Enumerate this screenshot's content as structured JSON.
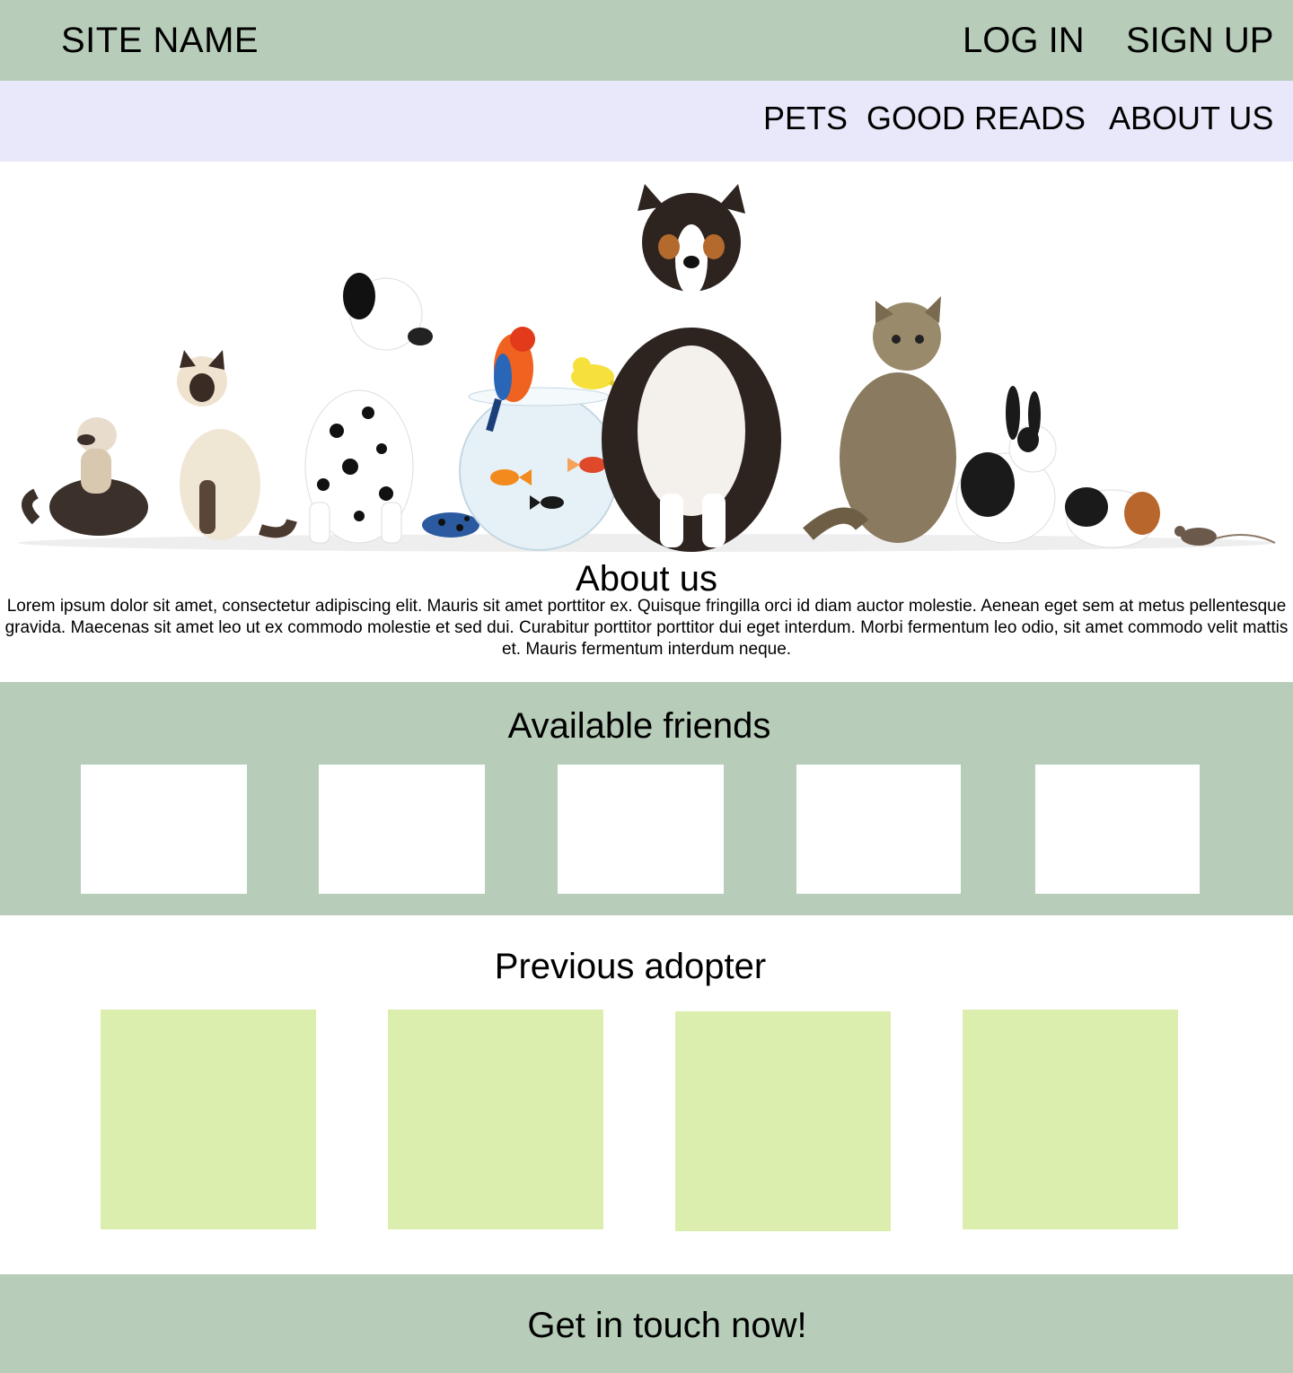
{
  "header": {
    "site_name": "SITE NAME",
    "login_label": "LOG IN",
    "signup_label": "SIGN UP"
  },
  "nav": {
    "items": [
      {
        "label": "PETS"
      },
      {
        "label": "GOOD READS"
      },
      {
        "label": "ABOUT US"
      }
    ]
  },
  "hero": {
    "subjects": [
      "ferret",
      "siamese-cat",
      "dalmatian",
      "parrot",
      "fishbowl",
      "goldfish",
      "canary",
      "frog",
      "collie",
      "tabby-cat",
      "rabbit",
      "guinea-pig",
      "mouse"
    ]
  },
  "about": {
    "title": "About us",
    "text": "Lorem ipsum dolor sit amet, consectetur adipiscing elit. Mauris sit amet porttitor ex. Quisque fringilla orci id diam auctor molestie. Aenean eget sem at metus pellentesque gravida. Maecenas sit amet leo ut ex commodo molestie et sed dui. Curabitur porttitor porttitor dui eget interdum. Morbi fermentum leo odio, sit amet commodo velit mattis et. Mauris fermentum interdum neque."
  },
  "friends": {
    "title": "Available friends",
    "cards": [
      {},
      {},
      {},
      {},
      {}
    ]
  },
  "adopters": {
    "title": "Previous adopter",
    "cards": [
      {},
      {},
      {},
      {}
    ]
  },
  "footer": {
    "cta": "Get in touch now!"
  },
  "colors": {
    "primary_band": "#b7cdb9",
    "nav_band": "#e9e8fa",
    "card_white": "#ffffff",
    "adopter_card": "#dceeae",
    "text": "#000000"
  }
}
